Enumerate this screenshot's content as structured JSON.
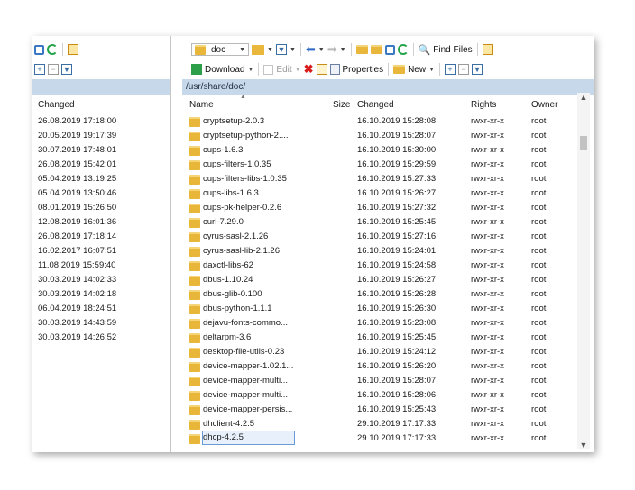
{
  "left_panel": {
    "header_changed": "Changed",
    "rows": [
      "26.08.2019 17:18:00",
      "20.05.2019 19:17:39",
      "30.07.2019 17:48:01",
      "26.08.2019 15:42:01",
      "05.04.2019 13:19:25",
      "05.04.2019 13:50:46",
      "08.01.2019 15:26:50",
      "12.08.2019 16:01:36",
      "26.08.2019 17:18:14",
      "16.02.2017 16:07:51",
      "11.08.2019 15:59:40",
      "30.03.2019 14:02:33",
      "30.03.2019 14:02:18",
      "06.04.2019 18:24:51",
      "30.03.2019 14:43:59",
      "30.03.2019 14:26:52"
    ]
  },
  "toolbar": {
    "location_combo": "doc",
    "find_files": "Find Files",
    "download": "Download",
    "edit": "Edit",
    "properties": "Properties",
    "new": "New"
  },
  "path": "/usr/share/doc/",
  "columns": {
    "name": "Name",
    "size": "Size",
    "changed": "Changed",
    "rights": "Rights",
    "owner": "Owner"
  },
  "files": [
    {
      "name": "cryptsetup-2.0.3",
      "changed": "16.10.2019 15:28:08",
      "rights": "rwxr-xr-x",
      "owner": "root"
    },
    {
      "name": "cryptsetup-python-2....",
      "changed": "16.10.2019 15:28:07",
      "rights": "rwxr-xr-x",
      "owner": "root"
    },
    {
      "name": "cups-1.6.3",
      "changed": "16.10.2019 15:30:00",
      "rights": "rwxr-xr-x",
      "owner": "root"
    },
    {
      "name": "cups-filters-1.0.35",
      "changed": "16.10.2019 15:29:59",
      "rights": "rwxr-xr-x",
      "owner": "root"
    },
    {
      "name": "cups-filters-libs-1.0.35",
      "changed": "16.10.2019 15:27:33",
      "rights": "rwxr-xr-x",
      "owner": "root"
    },
    {
      "name": "cups-libs-1.6.3",
      "changed": "16.10.2019 15:26:27",
      "rights": "rwxr-xr-x",
      "owner": "root"
    },
    {
      "name": "cups-pk-helper-0.2.6",
      "changed": "16.10.2019 15:27:32",
      "rights": "rwxr-xr-x",
      "owner": "root"
    },
    {
      "name": "curl-7.29.0",
      "changed": "16.10.2019 15:25:45",
      "rights": "rwxr-xr-x",
      "owner": "root"
    },
    {
      "name": "cyrus-sasl-2.1.26",
      "changed": "16.10.2019 15:27:16",
      "rights": "rwxr-xr-x",
      "owner": "root"
    },
    {
      "name": "cyrus-sasl-lib-2.1.26",
      "changed": "16.10.2019 15:24:01",
      "rights": "rwxr-xr-x",
      "owner": "root"
    },
    {
      "name": "daxctl-libs-62",
      "changed": "16.10.2019 15:24:58",
      "rights": "rwxr-xr-x",
      "owner": "root"
    },
    {
      "name": "dbus-1.10.24",
      "changed": "16.10.2019 15:26:27",
      "rights": "rwxr-xr-x",
      "owner": "root"
    },
    {
      "name": "dbus-glib-0.100",
      "changed": "16.10.2019 15:26:28",
      "rights": "rwxr-xr-x",
      "owner": "root"
    },
    {
      "name": "dbus-python-1.1.1",
      "changed": "16.10.2019 15:26:30",
      "rights": "rwxr-xr-x",
      "owner": "root"
    },
    {
      "name": "dejavu-fonts-commo...",
      "changed": "16.10.2019 15:23:08",
      "rights": "rwxr-xr-x",
      "owner": "root"
    },
    {
      "name": "deltarpm-3.6",
      "changed": "16.10.2019 15:25:45",
      "rights": "rwxr-xr-x",
      "owner": "root"
    },
    {
      "name": "desktop-file-utils-0.23",
      "changed": "16.10.2019 15:24:12",
      "rights": "rwxr-xr-x",
      "owner": "root"
    },
    {
      "name": "device-mapper-1.02.1...",
      "changed": "16.10.2019 15:26:20",
      "rights": "rwxr-xr-x",
      "owner": "root"
    },
    {
      "name": "device-mapper-multi...",
      "changed": "16.10.2019 15:28:07",
      "rights": "rwxr-xr-x",
      "owner": "root"
    },
    {
      "name": "device-mapper-multi...",
      "changed": "16.10.2019 15:28:06",
      "rights": "rwxr-xr-x",
      "owner": "root"
    },
    {
      "name": "device-mapper-persis...",
      "changed": "16.10.2019 15:25:43",
      "rights": "rwxr-xr-x",
      "owner": "root"
    },
    {
      "name": "dhclient-4.2.5",
      "changed": "29.10.2019 17:17:33",
      "rights": "rwxr-xr-x",
      "owner": "root"
    },
    {
      "name": "dhcp-4.2.5",
      "changed": "29.10.2019 17:17:33",
      "rights": "rwxr-xr-x",
      "owner": "root"
    }
  ],
  "colors": {
    "path_bar": "#c7d8ea",
    "folder": "#e8b73a",
    "selection": "#6a9bd8"
  }
}
